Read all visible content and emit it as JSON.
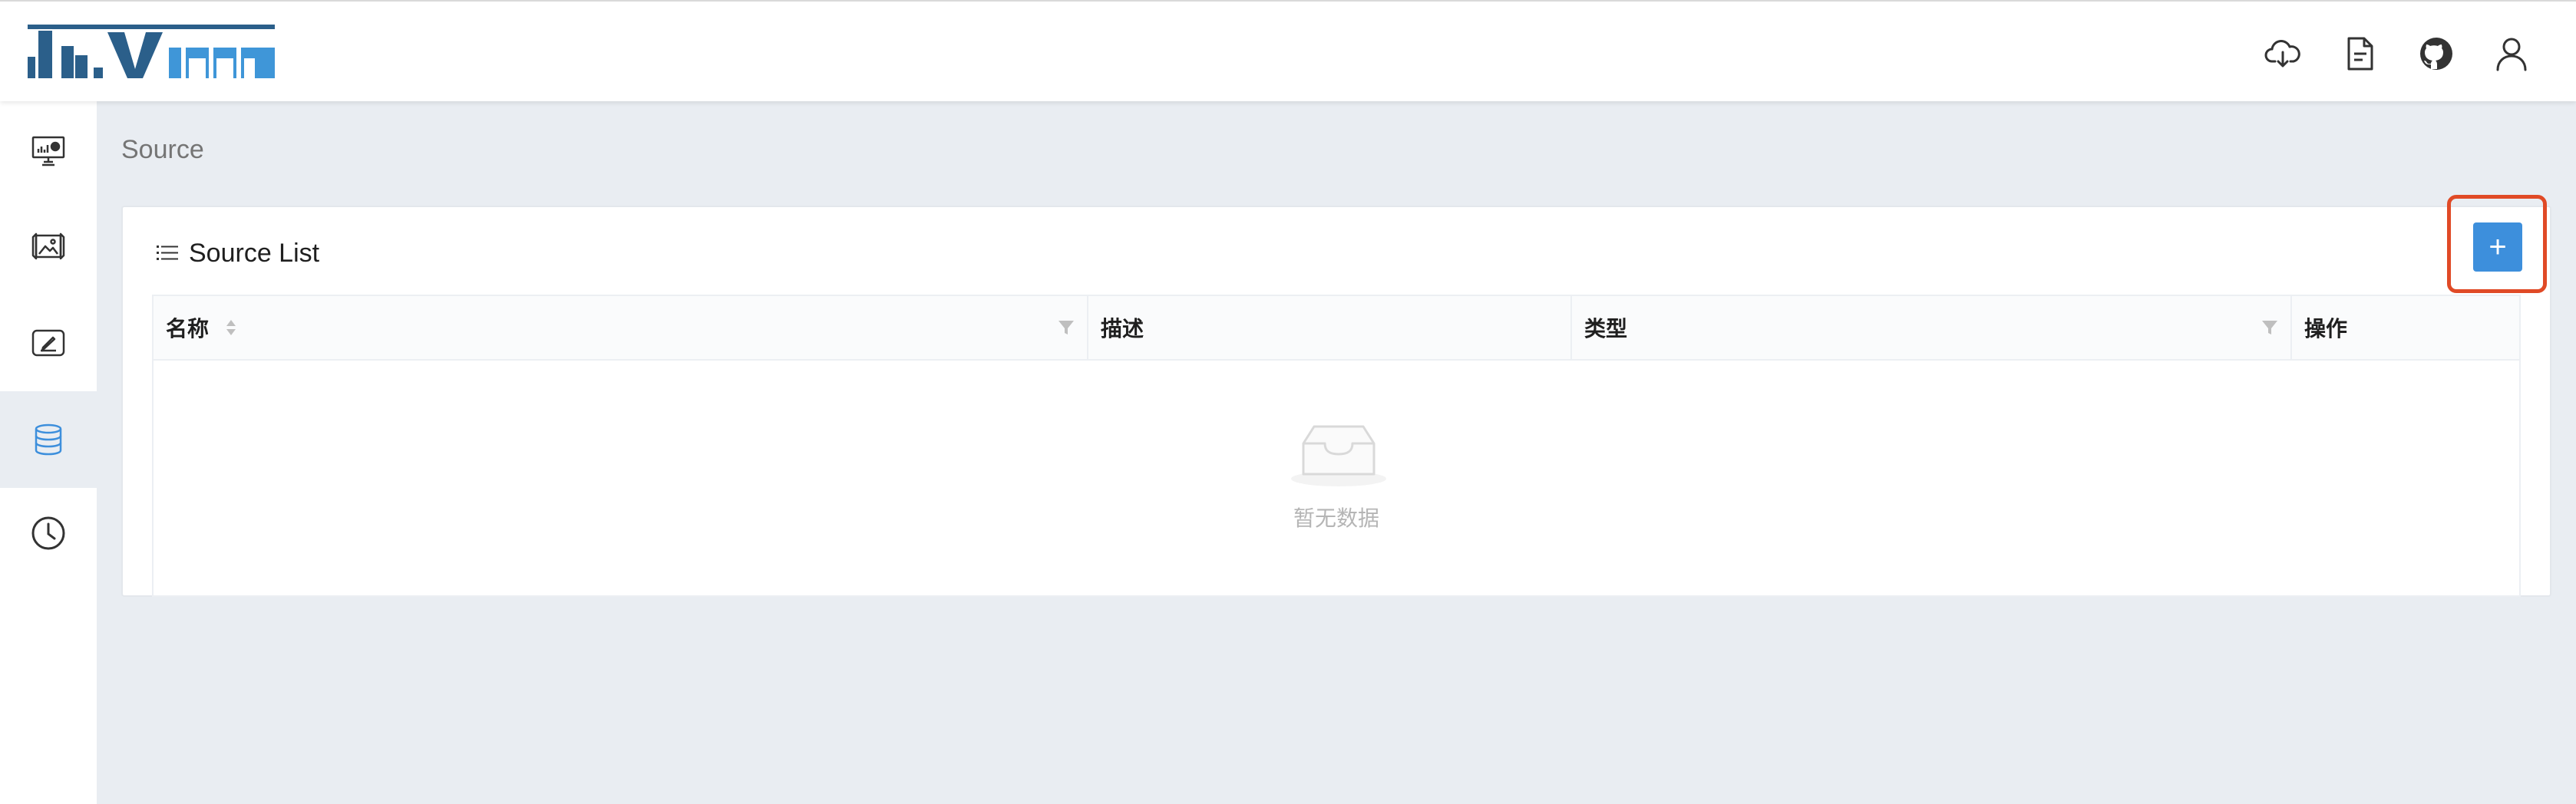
{
  "header": {
    "logo_text": "davinci",
    "icons": [
      "cloud-download-icon",
      "document-icon",
      "github-icon",
      "user-icon"
    ]
  },
  "sidebar": {
    "items": [
      {
        "name": "dashboard",
        "icon": "monitor-chart-icon",
        "active": false
      },
      {
        "name": "widget",
        "icon": "image-frame-icon",
        "active": false
      },
      {
        "name": "view",
        "icon": "edit-screen-icon",
        "active": false
      },
      {
        "name": "source",
        "icon": "database-icon",
        "active": true
      },
      {
        "name": "schedule",
        "icon": "clock-icon",
        "active": false
      }
    ]
  },
  "page": {
    "title": "Source"
  },
  "card": {
    "title": "Source List",
    "add_button_label": "+",
    "table": {
      "columns": [
        {
          "label": "名称",
          "sortable": true,
          "filterable": true
        },
        {
          "label": "描述",
          "sortable": false,
          "filterable": false
        },
        {
          "label": "类型",
          "sortable": false,
          "filterable": true
        },
        {
          "label": "操作",
          "sortable": false,
          "filterable": false
        }
      ],
      "rows": [],
      "empty_text": "暂无数据"
    }
  },
  "colors": {
    "accent": "#3d8fdc",
    "highlight": "#e04a26",
    "background": "#e9edf2",
    "logo_dark": "#2b5f8a",
    "logo_light": "#3f96d8"
  }
}
